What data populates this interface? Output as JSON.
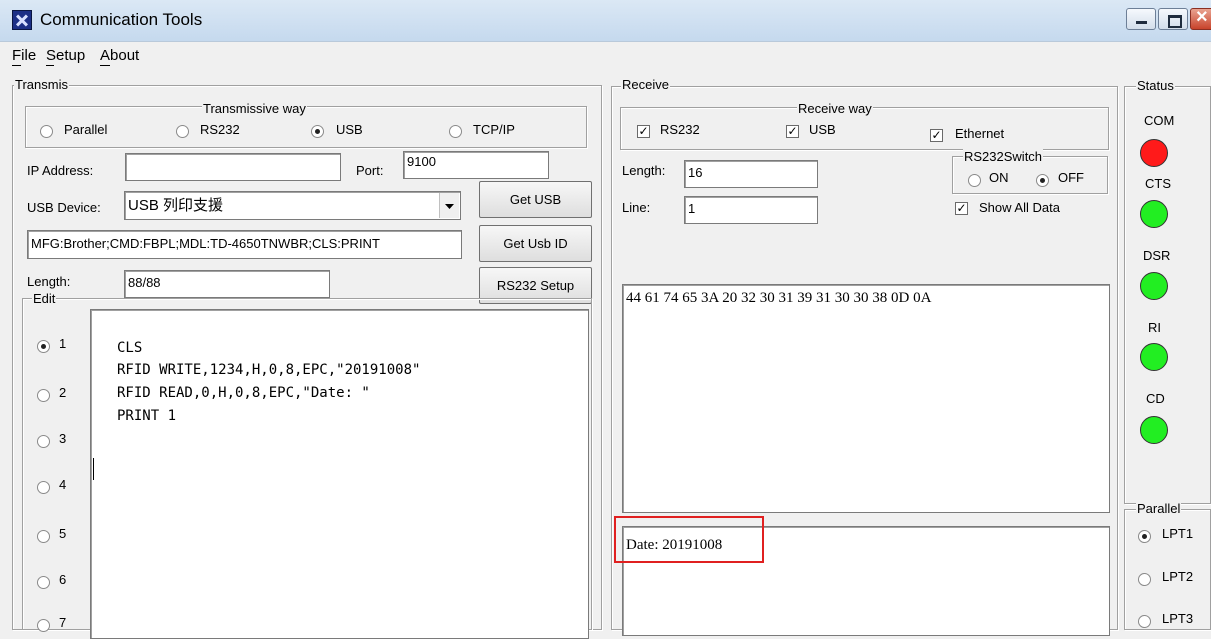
{
  "window": {
    "title": "Communication Tools"
  },
  "menu": [
    {
      "label": "File"
    },
    {
      "label": "Setup"
    },
    {
      "label": "About"
    }
  ],
  "transmit": {
    "group_label": "Transmis",
    "way_label": "Transmissive way",
    "ways": [
      {
        "label": "Parallel",
        "selected": false
      },
      {
        "label": "RS232",
        "selected": false
      },
      {
        "label": "USB",
        "selected": true
      },
      {
        "label": "TCP/IP",
        "selected": false
      }
    ],
    "ip_label": "IP Address:",
    "ip_value": "",
    "port_label": "Port:",
    "port_value": "9100",
    "usb_device_label": "USB Device:",
    "usb_device_value": "USB 列印支援",
    "usb_id_value": "MFG:Brother;CMD:FBPL;MDL:TD-4650TNWBR;CLS:PRINT",
    "length_label": "Length:",
    "length_value": "88/88",
    "buttons": {
      "get_usb": "Get USB",
      "get_usb_id": "Get Usb ID",
      "rs232_setup": "RS232 Setup"
    }
  },
  "edit": {
    "group_label": "Edit",
    "slots": [
      {
        "label": "1",
        "selected": true
      },
      {
        "label": "2",
        "selected": false
      },
      {
        "label": "3",
        "selected": false
      },
      {
        "label": "4",
        "selected": false
      },
      {
        "label": "5",
        "selected": false
      },
      {
        "label": "6",
        "selected": false
      },
      {
        "label": "7",
        "selected": false
      }
    ],
    "lines": [
      "CLS",
      "RFID WRITE,1234,H,0,8,EPC,\"20191008\"",
      "RFID READ,0,H,0,8,EPC,\"Date: \"",
      "PRINT 1"
    ]
  },
  "receive": {
    "group_label": "Receive",
    "way_label": "Receive way",
    "ways": [
      {
        "label": "RS232",
        "checked": true
      },
      {
        "label": "USB",
        "checked": true
      },
      {
        "label": "Ethernet",
        "checked": true
      }
    ],
    "length_label": "Length:",
    "length_value": "16",
    "line_label": "Line:",
    "line_value": "1",
    "switch_label": "RS232Switch",
    "switch_on": "ON",
    "switch_off": "OFF",
    "switch_selected": "OFF",
    "show_all_label": "Show All Data",
    "show_all_checked": true,
    "hex_output": "44 61 74 65 3A 20 32 30 31 39 31 30 30 38 0D 0A",
    "text_output": "Date: 20191008",
    "highlight_color": "#e02020"
  },
  "status": {
    "group_label": "Status",
    "indicators": [
      {
        "label": "COM",
        "color": "#ff1a1a"
      },
      {
        "label": "CTS",
        "color": "#22ee22"
      },
      {
        "label": "DSR",
        "color": "#22ee22"
      },
      {
        "label": "RI",
        "color": "#22ee22"
      },
      {
        "label": "CD",
        "color": "#22ee22"
      }
    ]
  },
  "parallel": {
    "group_label": "Parallel",
    "ports": [
      {
        "label": "LPT1",
        "selected": true
      },
      {
        "label": "LPT2",
        "selected": false
      },
      {
        "label": "LPT3",
        "selected": false
      }
    ]
  }
}
